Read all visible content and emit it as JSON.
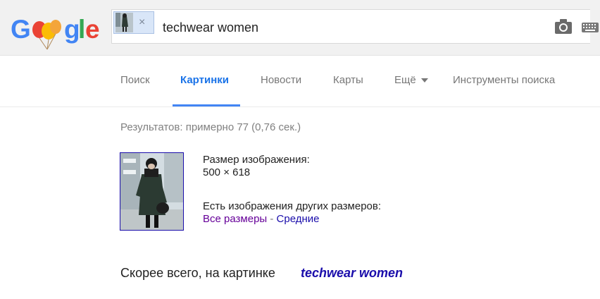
{
  "logo": {
    "g1": "G",
    "l": "l",
    "e": "e",
    "g2": "g"
  },
  "search": {
    "query": "techwear women",
    "close_symbol": "×"
  },
  "nav": {
    "items": [
      "Поиск",
      "Картинки",
      "Новости",
      "Карты",
      "Ещё",
      "Инструменты поиска"
    ],
    "active": "Картинки"
  },
  "results": {
    "stats": "Результатов: примерно 77 (0,76 сек.)"
  },
  "image_info": {
    "size_label": "Размер изображения:",
    "size_value": "500 × 618",
    "other_sizes_label": "Есть изображения других размеров:",
    "all_sizes": "Все размеры",
    "separator": " - ",
    "medium": "Средние"
  },
  "guess": {
    "label": "Скорее всего, на картинке",
    "value": "techwear women"
  },
  "colors": {
    "blue": "#4285f4",
    "red": "#ea4335",
    "yellow": "#fbbc05",
    "green": "#34a853",
    "active_tab": "#1a73e8",
    "link": "#1a0dab",
    "visited": "#660099"
  }
}
